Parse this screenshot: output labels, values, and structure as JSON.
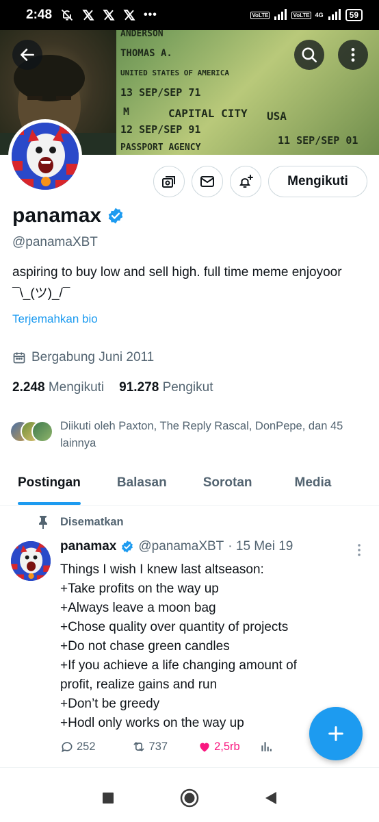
{
  "status_bar": {
    "time": "2:48",
    "notification_icons": [
      "bell-off-icon",
      "x-logo-icon",
      "x-logo-icon",
      "x-logo-icon"
    ],
    "more": "•••",
    "network_label_1": "VoLTE",
    "network_label_2": "VoLTE",
    "network_type": "4G",
    "battery": "59"
  },
  "banner": {
    "lines": [
      "ANDERSON",
      "THOMAS A.",
      "UNITED STATES OF AMERICA",
      "13 SEP/SEP 71",
      "M",
      "CAPITAL CITY",
      "USA",
      "12 SEP/SEP 91",
      "11 SEP/SEP 01",
      "PASSPORT AGENCY"
    ]
  },
  "profile": {
    "name": "panamax",
    "handle": "@panamaXBT",
    "bio": "aspiring to buy low and sell high. full time meme enjoyoor ¯\\_(ツ)_/¯",
    "translate_link": "Terjemahkan bio",
    "joined": "Bergabung Juni 2011",
    "following_count": "2.248",
    "following_label": "Mengikuti",
    "followers_count": "91.278",
    "followers_label": "Pengikut",
    "followed_by": "Diikuti oleh Paxton, The Reply Rascal, DonPepe, dan 45 lainnya",
    "follow_button": "Mengikuti"
  },
  "tabs": [
    {
      "label": "Postingan",
      "active": true
    },
    {
      "label": "Balasan",
      "active": false
    },
    {
      "label": "Sorotan",
      "active": false
    },
    {
      "label": "Media",
      "active": false
    }
  ],
  "pinned_post": {
    "pinned_label": "Disematkan",
    "author_name": "panamax",
    "author_handle": "@panamaXBT",
    "date": "· 15 Mei 19",
    "lines": [
      "Things I wish I knew last altseason:",
      "+Take profits on the way up",
      "+Always leave a moon bag",
      "+Chose quality over quantity of projects",
      "+Do not chase green candles",
      "+If you achieve a life changing amount of",
      "profit, realize gains and run",
      "+Don’t be greedy",
      "+Hodl only works on the way up"
    ],
    "replies": "252",
    "reposts": "737",
    "likes": "2,5rb"
  },
  "colors": {
    "accent": "#1d9bf0",
    "like": "#f91880",
    "muted": "#536471"
  }
}
